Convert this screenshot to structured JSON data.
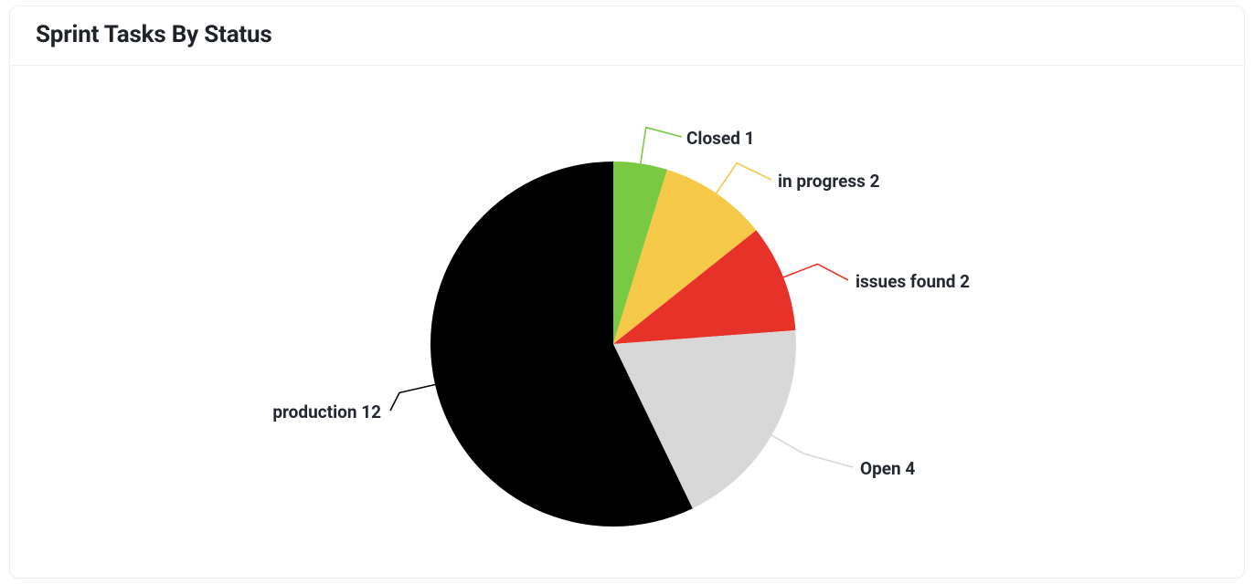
{
  "card": {
    "title": "Sprint Tasks By Status"
  },
  "chart_data": {
    "type": "pie",
    "title": "Sprint Tasks By Status",
    "categories": [
      "Closed",
      "in progress",
      "issues found",
      "Open",
      "production"
    ],
    "values": [
      1,
      2,
      2,
      4,
      12
    ],
    "colors": [
      "#7ac943",
      "#f7c948",
      "#e7322a",
      "#d8d8d8",
      "#000000"
    ]
  },
  "labels": {
    "closed": "Closed 1",
    "in_progress": "in progress 2",
    "issues_found": "issues found 2",
    "open": "Open 4",
    "production": "production 12"
  }
}
